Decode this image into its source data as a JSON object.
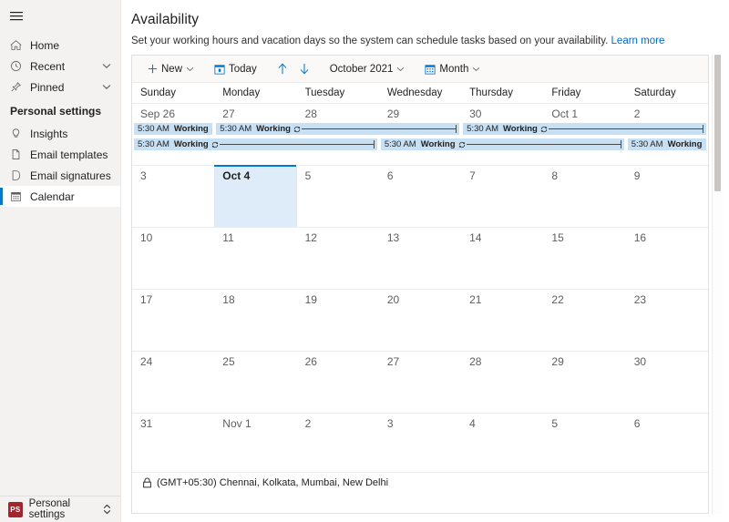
{
  "sidebar": {
    "menu_icon": "hamburger-icon",
    "items": [
      {
        "label": "Home",
        "icon": "home-icon",
        "chevron": false,
        "selected": false
      },
      {
        "label": "Recent",
        "icon": "clock-icon",
        "chevron": true,
        "selected": false
      },
      {
        "label": "Pinned",
        "icon": "pin-icon",
        "chevron": true,
        "selected": false
      }
    ],
    "group_title": "Personal settings",
    "group_items": [
      {
        "label": "Insights",
        "icon": "lightbulb-icon",
        "selected": false
      },
      {
        "label": "Email templates",
        "icon": "document-icon",
        "selected": false
      },
      {
        "label": "Email signatures",
        "icon": "signature-icon",
        "selected": false
      },
      {
        "label": "Calendar",
        "icon": "calendar-icon",
        "selected": true
      }
    ],
    "footer": {
      "badge": "PS",
      "label": "Personal settings",
      "switch_icon": "up-down-chevron-icon",
      "badge_color": "#a4262c"
    }
  },
  "header": {
    "title": "Availability",
    "description": "Set your working hours and vacation days so the system can schedule tasks based on your availability.",
    "link_label": "Learn more"
  },
  "toolbar": {
    "new_label": "New",
    "new_icon": "plus-icon",
    "new_chevron": "chevron-down-icon",
    "today_label": "Today",
    "today_icon": "today-calendar-icon",
    "prev_icon": "arrow-up-icon",
    "next_icon": "arrow-down-icon",
    "period_label": "October 2021",
    "period_chevron": "chevron-down-icon",
    "view_label": "Month",
    "view_icon": "month-grid-icon",
    "view_chevron": "chevron-down-icon"
  },
  "weekdays": [
    "Sunday",
    "Monday",
    "Tuesday",
    "Wednesday",
    "Thursday",
    "Friday",
    "Saturday"
  ],
  "event": {
    "time": "5:30 AM",
    "subject": "Working",
    "recurrence_icon": "recurrence-icon",
    "color": "#c7e0f4"
  },
  "weeks": [
    {
      "days": [
        {
          "num": "Sep 26",
          "selected": false
        },
        {
          "num": "27",
          "selected": false
        },
        {
          "num": "28",
          "selected": false
        },
        {
          "num": "29",
          "selected": false
        },
        {
          "num": "30",
          "selected": false
        },
        {
          "num": "Oct 1",
          "selected": false
        },
        {
          "num": "2",
          "selected": false
        }
      ]
    },
    {
      "days": [
        {
          "num": "3",
          "selected": false
        },
        {
          "num": "Oct 4",
          "selected": true
        },
        {
          "num": "5",
          "selected": false
        },
        {
          "num": "6",
          "selected": false
        },
        {
          "num": "7",
          "selected": false
        },
        {
          "num": "8",
          "selected": false
        },
        {
          "num": "9",
          "selected": false
        }
      ]
    },
    {
      "days": [
        {
          "num": "10",
          "selected": false
        },
        {
          "num": "11",
          "selected": false
        },
        {
          "num": "12",
          "selected": false
        },
        {
          "num": "13",
          "selected": false
        },
        {
          "num": "14",
          "selected": false
        },
        {
          "num": "15",
          "selected": false
        },
        {
          "num": "16",
          "selected": false
        }
      ]
    },
    {
      "days": [
        {
          "num": "17",
          "selected": false
        },
        {
          "num": "18",
          "selected": false
        },
        {
          "num": "19",
          "selected": false
        },
        {
          "num": "20",
          "selected": false
        },
        {
          "num": "21",
          "selected": false
        },
        {
          "num": "22",
          "selected": false
        },
        {
          "num": "23",
          "selected": false
        }
      ]
    },
    {
      "days": [
        {
          "num": "24",
          "selected": false
        },
        {
          "num": "25",
          "selected": false
        },
        {
          "num": "26",
          "selected": false
        },
        {
          "num": "27",
          "selected": false
        },
        {
          "num": "28",
          "selected": false
        },
        {
          "num": "29",
          "selected": false
        },
        {
          "num": "30",
          "selected": false
        }
      ]
    },
    {
      "days": [
        {
          "num": "31",
          "selected": false
        },
        {
          "num": "Nov 1",
          "selected": false
        },
        {
          "num": "2",
          "selected": false
        },
        {
          "num": "3",
          "selected": false
        },
        {
          "num": "4",
          "selected": false
        },
        {
          "num": "5",
          "selected": false
        },
        {
          "num": "6",
          "selected": false
        }
      ]
    }
  ],
  "timezone": {
    "icon": "lock-icon",
    "label": "(GMT+05:30) Chennai, Kolkata, Mumbai, New Delhi"
  }
}
